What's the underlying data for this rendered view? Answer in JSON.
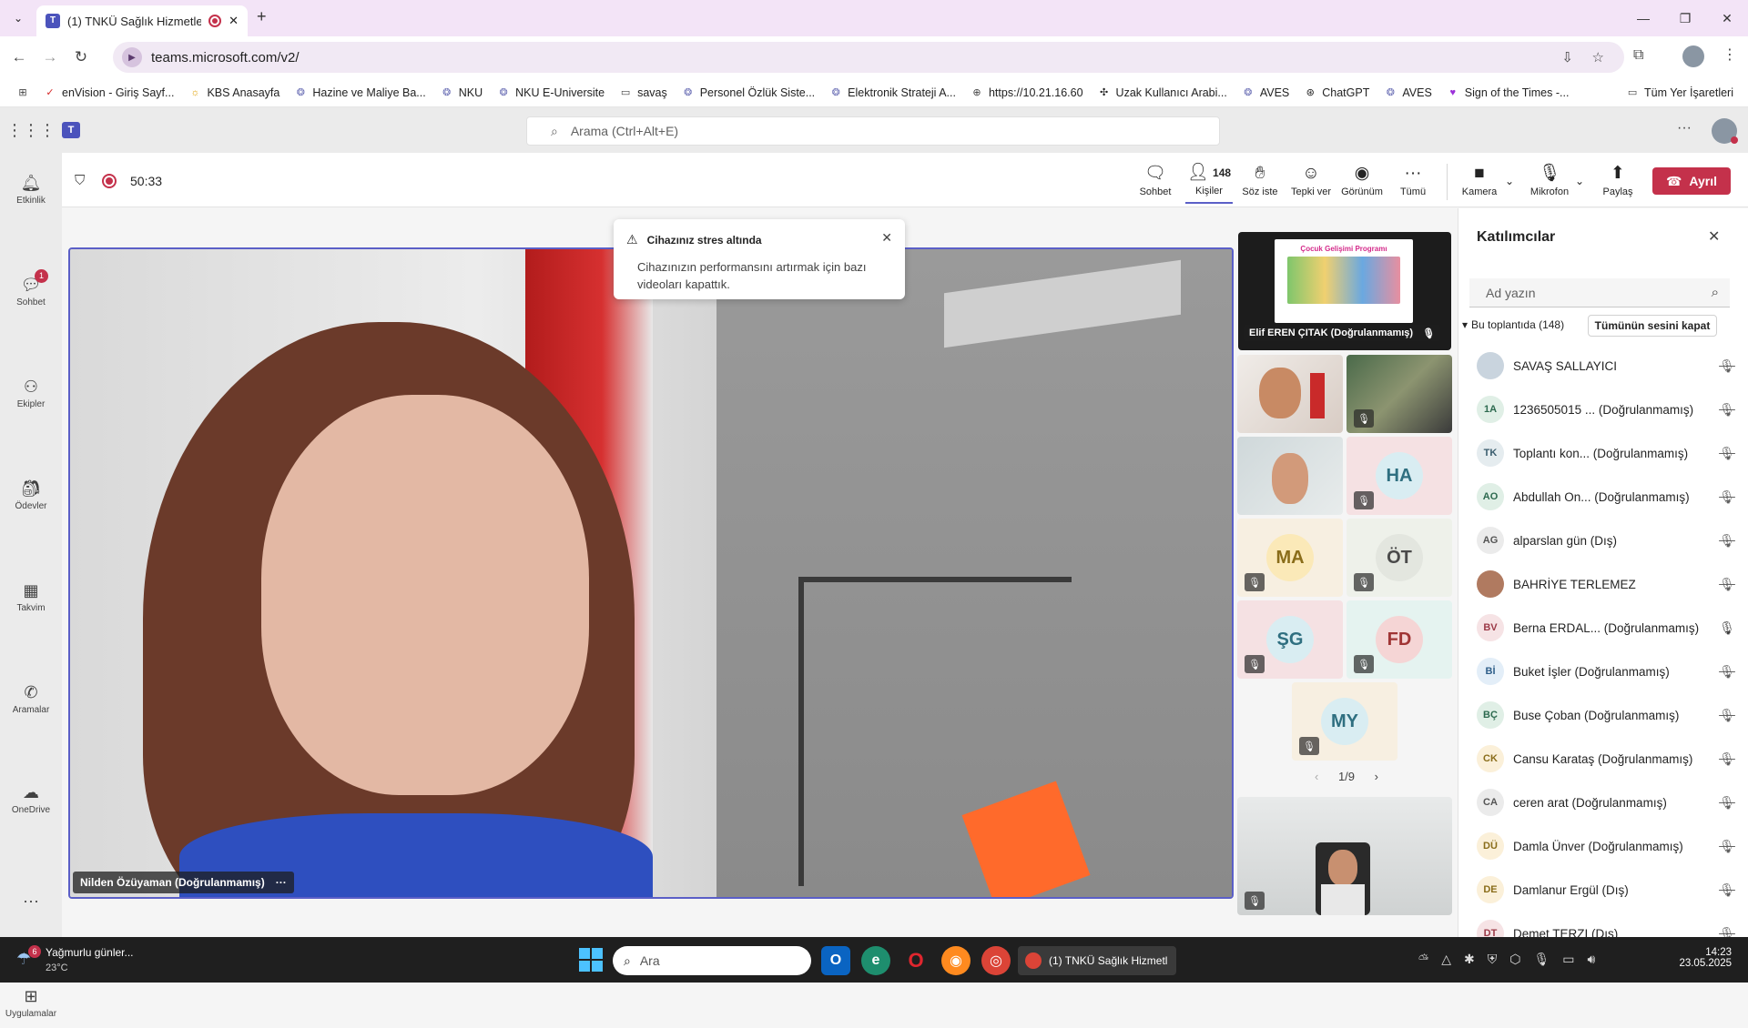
{
  "browser": {
    "tab_title": "(1) TNKÜ Sağlık Hizmetleri",
    "url": "teams.microsoft.com/v2/",
    "bookmarks": [
      "enVision - Giriş Sayf...",
      "KBS Anasayfa",
      "Hazine ve Maliye Ba...",
      "NKU",
      "NKU E-Universite",
      "savaş",
      "Personel Özlük Siste...",
      "Elektronik Strateji A...",
      "https://10.21.16.60",
      "Uzak Kullanıcı Arabi...",
      "AVES",
      "ChatGPT",
      "AVES",
      "Sign of the Times -..."
    ],
    "all_bookmarks": "Tüm Yer İşaretleri"
  },
  "teams": {
    "search_placeholder": "Arama (Ctrl+Alt+E)",
    "rail": [
      {
        "label": "Etkinlik",
        "icon": "bell-icon",
        "glyph": "🔔︎"
      },
      {
        "label": "Sohbet",
        "icon": "chat-icon",
        "glyph": "💬︎",
        "badge": "1"
      },
      {
        "label": "Ekipler",
        "icon": "teams-icon",
        "glyph": "⚇"
      },
      {
        "label": "Ödevler",
        "icon": "assignments-icon",
        "glyph": "🎒︎"
      },
      {
        "label": "Takvim",
        "icon": "calendar-icon",
        "glyph": "▦"
      },
      {
        "label": "Aramalar",
        "icon": "phone-icon",
        "glyph": "✆"
      },
      {
        "label": "OneDrive",
        "icon": "cloud-icon",
        "glyph": "☁"
      },
      {
        "label": "",
        "icon": "more-icon",
        "glyph": "···"
      },
      {
        "label": "Uygulamalar",
        "icon": "apps-icon",
        "glyph": "⊞"
      }
    ],
    "meeting": {
      "timer": "50:33",
      "people_count": "148",
      "toolbar": {
        "chat": "Sohbet",
        "people": "Kişiler",
        "raise": "Söz iste",
        "react": "Tepki ver",
        "view": "Görünüm",
        "more": "Tümü",
        "camera": "Kamera",
        "mic": "Mikrofon",
        "share": "Paylaş",
        "leave": "Ayrıl"
      }
    },
    "toast": {
      "title": "Cihazınız stres altında",
      "body": "Cihazınızın performansını artırmak için bazı videoları kapattık."
    },
    "main_speaker": "Nilden Özüyaman (Doğrulanmamış)",
    "share_tile": {
      "name": "Elif EREN ÇITAK (Doğrulanmamış)",
      "slide_title": "Çocuk Gelişimi Programı"
    },
    "tiles": [
      {
        "initials": "HA",
        "bg": "#f5e1e3",
        "fg": "#b03a48",
        "circle": "#d9edf2",
        "text": "#2f6f80"
      },
      {
        "initials": "MA",
        "bg": "#f7efe1",
        "fg": "#8a6d1a",
        "circle": "#fbe9b8",
        "text": "#8a6d1a"
      },
      {
        "initials": "ÖT",
        "bg": "#eef1ea",
        "fg": "#555",
        "circle": "#e3e6df",
        "text": "#4a4a4a"
      },
      {
        "initials": "ŞG",
        "bg": "#f5e1e3",
        "fg": "#2f6f80",
        "circle": "#d9edf2",
        "text": "#2f6f80"
      },
      {
        "initials": "FD",
        "bg": "#e5f3f0",
        "fg": "#a03535",
        "circle": "#f5d5d5",
        "text": "#a03535"
      },
      {
        "initials": "MY",
        "bg": "#f7efe1",
        "fg": "#2f6f80",
        "circle": "#d9edf2",
        "text": "#2f6f80"
      }
    ],
    "pager": "1/9",
    "participants": {
      "title": "Katılımcılar",
      "search_placeholder": "Ad yazın",
      "section": "Bu toplantıda (148)",
      "mute_all": "Tümünün sesini kapat",
      "list": [
        {
          "initials": "",
          "name": "SAVAŞ SALLAYICI",
          "photo": true,
          "bg": "#c9d4de",
          "fg": "#333",
          "mic": "muted"
        },
        {
          "initials": "1A",
          "name": "1236505015 ... (Doğrulanmamış)",
          "bg": "#e0efe6",
          "fg": "#2d6a4f",
          "mic": "muted"
        },
        {
          "initials": "TK",
          "name": "Toplantı kon... (Doğrulanmamış)",
          "bg": "#e5ecef",
          "fg": "#3b5d6e",
          "mic": "muted"
        },
        {
          "initials": "AO",
          "name": "Abdullah On... (Doğrulanmamış)",
          "bg": "#e0efe6",
          "fg": "#2d6a4f",
          "mic": "muted"
        },
        {
          "initials": "AG",
          "name": "alparslan gün (Dış)",
          "bg": "#ebebeb",
          "fg": "#555",
          "mic": "muted"
        },
        {
          "initials": "",
          "name": "BAHRİYE TERLEMEZ",
          "photo": true,
          "bg": "#b07a60",
          "fg": "#fff",
          "mic": "muted"
        },
        {
          "initials": "BV",
          "name": "Berna ERDAL... (Doğrulanmamış)",
          "bg": "#f6e3e5",
          "fg": "#9c3a48",
          "mic": "on"
        },
        {
          "initials": "Bİ",
          "name": "Buket İşler (Doğrulanmamış)",
          "bg": "#e3eef8",
          "fg": "#2f5f8a",
          "mic": "muted"
        },
        {
          "initials": "BÇ",
          "name": "Buse Çoban (Doğrulanmamış)",
          "bg": "#e0efe6",
          "fg": "#2d6a4f",
          "mic": "muted"
        },
        {
          "initials": "CK",
          "name": "Cansu Karataş (Doğrulanmamış)",
          "bg": "#fbf0d9",
          "fg": "#8a6d1a",
          "mic": "muted"
        },
        {
          "initials": "CA",
          "name": "ceren arat (Doğrulanmamış)",
          "bg": "#ebebeb",
          "fg": "#555",
          "mic": "muted"
        },
        {
          "initials": "DÜ",
          "name": "Damla Ünver (Doğrulanmamış)",
          "bg": "#fbf0d9",
          "fg": "#8a6d1a",
          "mic": "muted"
        },
        {
          "initials": "DE",
          "name": "Damlanur Ergül (Dış)",
          "bg": "#fbf0d9",
          "fg": "#8a6d1a",
          "mic": "muted"
        },
        {
          "initials": "DT",
          "name": "Demet TERZI (Dış)",
          "bg": "#f6e3e5",
          "fg": "#9c3a48",
          "mic": "muted"
        }
      ]
    }
  },
  "taskbar": {
    "weather": "Yağmurlu günler...",
    "temp": "23°C",
    "weather_badge": "6",
    "search": "Ara",
    "active_app": "(1) TNKÜ Sağlık Hizmetl",
    "time": "14:23",
    "date": "23.05.2025"
  }
}
